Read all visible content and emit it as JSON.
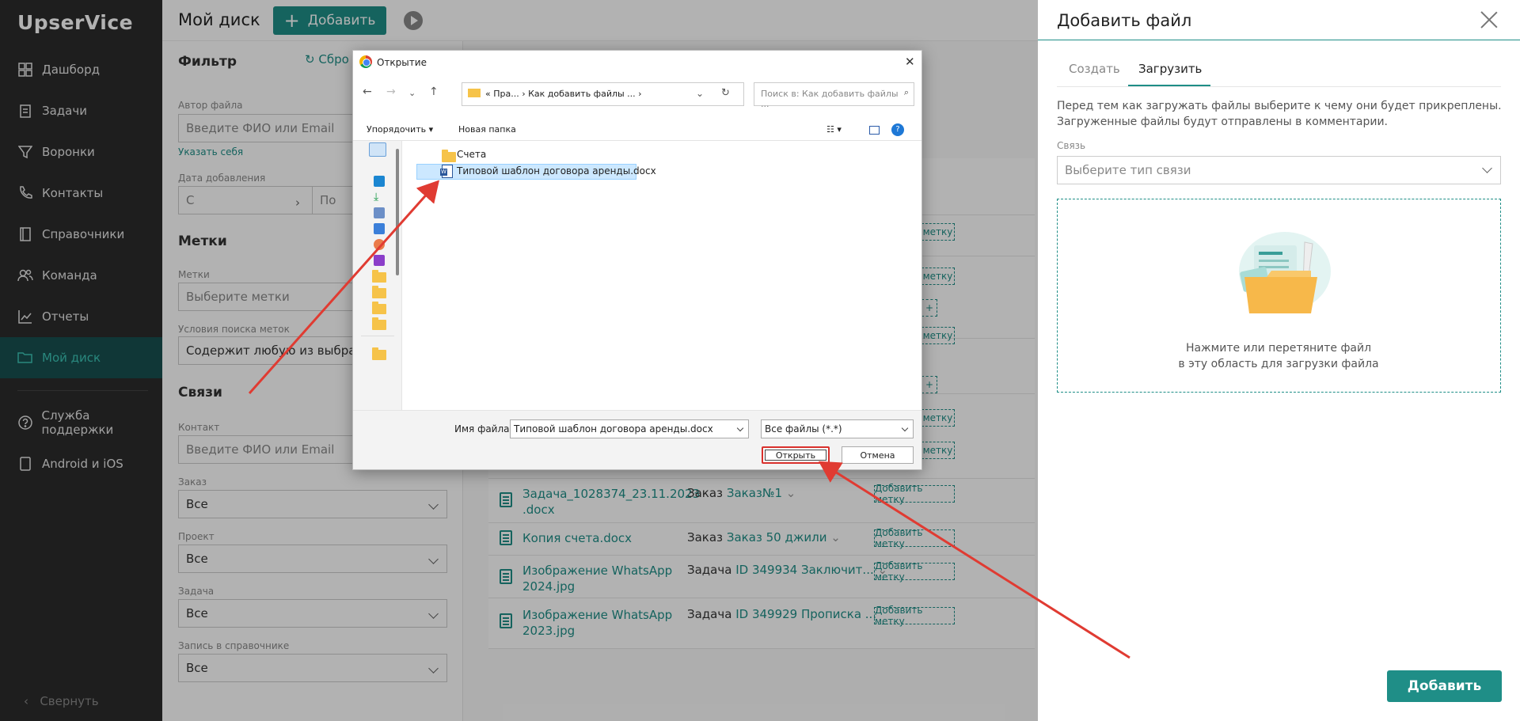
{
  "sidebar": {
    "logo": "UpserVice",
    "items": [
      {
        "label": "Дашборд",
        "icon": "dashboard-icon"
      },
      {
        "label": "Задачи",
        "icon": "tasks-icon"
      },
      {
        "label": "Воронки",
        "icon": "funnel-icon"
      },
      {
        "label": "Контакты",
        "icon": "phone-icon"
      },
      {
        "label": "Справочники",
        "icon": "book-icon"
      },
      {
        "label": "Команда",
        "icon": "team-icon"
      },
      {
        "label": "Отчеты",
        "icon": "chart-icon"
      },
      {
        "label": "Мой диск",
        "icon": "folder-icon",
        "active": true
      }
    ],
    "bottom_items": [
      {
        "label": "Служба поддержки",
        "icon": "help-icon"
      },
      {
        "label": "Android и iOS",
        "icon": "mobile-icon"
      }
    ],
    "collapse": "Свернуть"
  },
  "header": {
    "title": "Мой диск",
    "add_button": "Добавить"
  },
  "filter": {
    "title": "Фильтр",
    "reset": "Сбро",
    "author_label": "Автор файла",
    "author_placeholder": "Введите ФИО или Email",
    "set_self": "Указать себя",
    "date_label": "Дата добавления",
    "date_from": "С",
    "date_to": "По",
    "tags_title": "Метки",
    "tags_label": "Метки",
    "tags_placeholder": "Выберите метки",
    "tag_cond_label": "Условия поиска меток",
    "tag_cond_value": "Содержит любую из выбранны",
    "links_title": "Связи",
    "contact_label": "Контакт",
    "contact_placeholder": "Введите ФИО или Email",
    "order_label": "Заказ",
    "order_value": "Все",
    "project_label": "Проект",
    "project_value": "Все",
    "task_label": "Задача",
    "task_value": "Все",
    "ref_label": "Запись в справочнике",
    "ref_value": "Все"
  },
  "files": {
    "rows": [
      {
        "name": "Задача_1028374_23.11.2023 .docx",
        "link_type": "Заказ",
        "link_value": "Заказ№1",
        "tag": "Добавить метку"
      },
      {
        "name": "Копия счета.docx",
        "link_type": "Заказ",
        "link_value": "Заказ 50 джили",
        "tag": "Добавить метку"
      },
      {
        "name": "Изображение WhatsApp 2024.jpg",
        "link_type": "Задача",
        "link_value": "ID 349934 Заключит...",
        "tag": "Добавить метку"
      },
      {
        "name": "Изображение WhatsApp 2023.jpg",
        "link_type": "Задача",
        "link_value": "ID 349929 Прописка ...",
        "tag": "Добавить метку"
      }
    ],
    "partial_tags": [
      "метку",
      "метку",
      "метку",
      "метку",
      "метку"
    ],
    "partial_plus": [
      "+",
      "+"
    ]
  },
  "drawer": {
    "title": "Добавить файл",
    "tabs": [
      "Создать",
      "Загрузить"
    ],
    "info_line1": "Перед тем как загружать файлы выберите к чему они будет прикреплены.",
    "info_line2": "Загруженные файлы будут отправлены в комментарии.",
    "link_label": "Связь",
    "link_placeholder": "Выберите тип связи",
    "drop_line1": "Нажмите или перетяните файл",
    "drop_line2": "в эту область для загрузки файла",
    "add_button": "Добавить"
  },
  "dialog": {
    "title": "Открытие",
    "path": "«  Пра...  ›  Как добавить файлы ...  ›",
    "search_placeholder": "Поиск в: Как добавить файлы ...",
    "organize": "Упорядочить ▾",
    "new_folder": "Новая папка",
    "items": [
      {
        "name": "Счета",
        "type": "folder"
      },
      {
        "name": "Типовой шаблон договора аренды.docx",
        "type": "docx",
        "selected": true
      }
    ],
    "filename_label": "Имя файла:",
    "filename_value": "Типовой шаблон договора аренды.docx",
    "filetype_value": "Все файлы (*.*)",
    "open_button": "Открыть",
    "cancel_button": "Отмена"
  },
  "colors": {
    "accent": "#1f8e87",
    "sidebar_bg": "#2b2b2b",
    "arrow": "#e03b32"
  }
}
